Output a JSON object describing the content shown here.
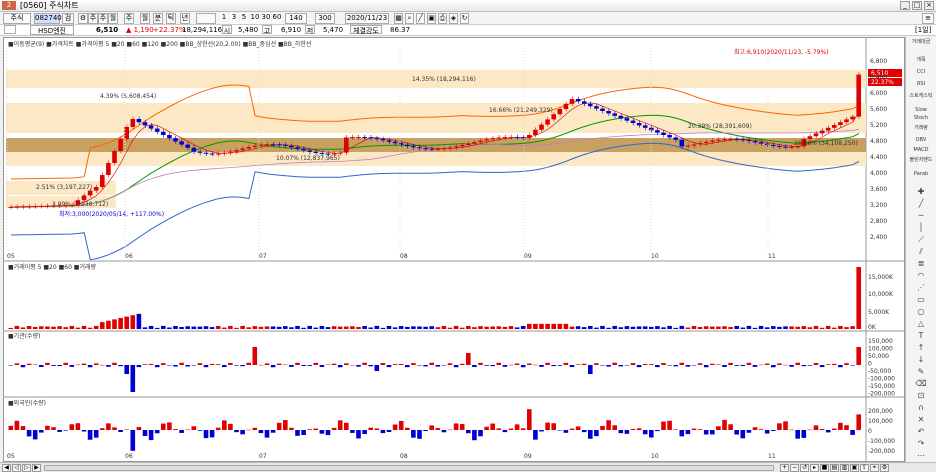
{
  "window": {
    "number": "2",
    "title": "[0560] 주식차트",
    "controls": [
      "_",
      "□",
      "×"
    ]
  },
  "toolbar": {
    "market": "주식",
    "code": "082740",
    "name_btn": "검",
    "chart_buttons": [
      "주",
      "주",
      "월",
      "분",
      "틱",
      "년"
    ],
    "intervals": [
      "1",
      "3",
      "5",
      "10",
      "30",
      "60"
    ],
    "count": "140",
    "max": "300",
    "date": "2020/11/23"
  },
  "info": {
    "stock_name": "HSD엔진",
    "price": "6,510",
    "change": "▲ 1,190",
    "rate": "+22.37%",
    "volume": "18,294,116",
    "high_label": "고",
    "high": "5,480",
    "low_label": "고",
    "low_val": "6,910",
    "low2_label": "저",
    "low2": "5,470",
    "strength_label": "체결강도",
    "strength": "86.37",
    "zoom": "[1일]"
  },
  "legend": {
    "main": "■이동평균(9) ■가격차트 ■가격이평 5 ■20 ■60 ■120 ■200 ■BB_상한선(20,2.00) ■BB_중심선 ■BB_하한선",
    "volume": "■거래이평 5 ■20 ■60 ■거래량",
    "inst": "■기관(수량)",
    "foreign": "■외국인(수량)"
  },
  "annotations": {
    "max": "최고:6,910(2020/11/23, -5.79%)",
    "min": "최저:3,000(2020/05/14, +117.00%)",
    "fib1": "14.35% (18,294,116)",
    "fib2": "4.39% (5,608,454)",
    "fib3": "16.66% (21,249,329)",
    "fib4": "10.07% (12,837,965)",
    "fib5": "2.51% (3,197,227)",
    "fib6": "3.09% (3,938,712)",
    "fib7": "20.39% (28,391,609)",
    "fib8": "26.88% (34,108,250)",
    "last_price": "6,510",
    "last_rate": "22.37%"
  },
  "price_axis": [
    "6,800",
    "6,400",
    "6,000",
    "5,600",
    "5,200",
    "4,800",
    "4,400",
    "4,000",
    "3,600",
    "3,200",
    "2,800",
    "2,400"
  ],
  "volume_axis": [
    "15,000K",
    "10,000K",
    "5,000K",
    "0K"
  ],
  "inst_axis": [
    "150,000",
    "100,000",
    "50,000",
    "0",
    "-50,000",
    "-100,000",
    "-150,000",
    "-200,000"
  ],
  "foreign_axis": [
    "200,000",
    "100,000",
    "0",
    "-100,000",
    "-200,000"
  ],
  "months": [
    "05",
    "06",
    "07",
    "08",
    "09",
    "10",
    "11"
  ],
  "right_panel": [
    "거래대금",
    "개폭",
    "CCI",
    "RSI",
    "스토캐스틱",
    "Slow",
    "Stoch",
    "거래량",
    "OBV",
    "MACD",
    "볼린저밴드",
    "Parab"
  ],
  "colors": {
    "up": "#e00000",
    "down": "#0000d0",
    "bb_band": "#ff6600",
    "bb_mid": "#009900",
    "bb_low": "#3366cc",
    "ma60": "#c080c0",
    "fib_fill": "#fce8c4",
    "fib_dark": "#c8a060"
  }
}
